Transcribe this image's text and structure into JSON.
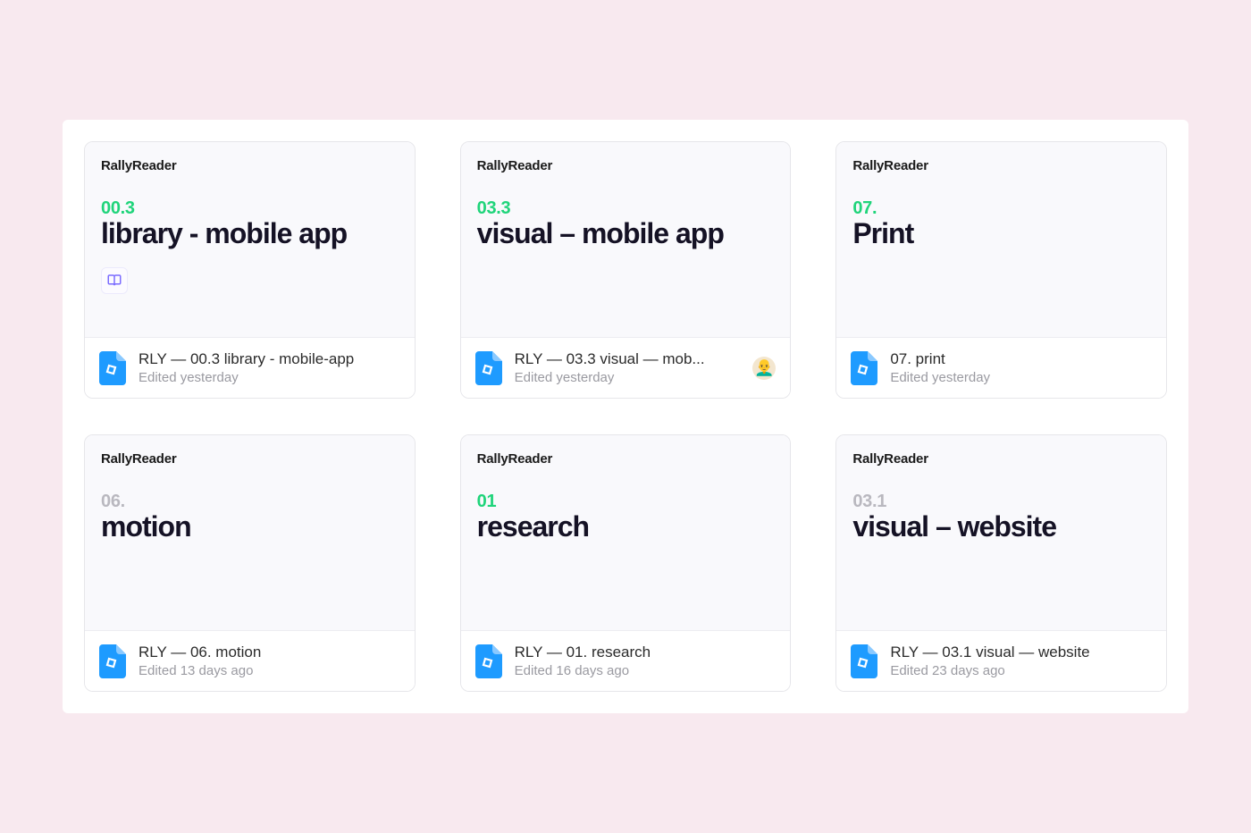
{
  "brand": "RallyReader",
  "cards": [
    {
      "num": "00.3",
      "num_color": "green",
      "title": "library - mobile app",
      "has_book_tag": true,
      "file_title": "RLY — 00.3 library - mobile-app",
      "edited": "Edited yesterday",
      "has_avatar": false
    },
    {
      "num": "03.3",
      "num_color": "green",
      "title": "visual – mobile app",
      "has_book_tag": false,
      "file_title": "RLY — 03.3 visual — mob...",
      "edited": "Edited yesterday",
      "has_avatar": true
    },
    {
      "num": "07.",
      "num_color": "green",
      "title": "Print",
      "has_book_tag": false,
      "file_title": "07. print",
      "edited": "Edited yesterday",
      "has_avatar": false
    },
    {
      "num": "06.",
      "num_color": "gray",
      "title": "motion",
      "has_book_tag": false,
      "file_title": "RLY — 06. motion",
      "edited": "Edited 13 days ago",
      "has_avatar": false
    },
    {
      "num": "01",
      "num_color": "green",
      "title": "research",
      "has_book_tag": false,
      "file_title": "RLY — 01. research",
      "edited": "Edited 16 days ago",
      "has_avatar": false
    },
    {
      "num": "03.1",
      "num_color": "gray",
      "title": "visual – website",
      "has_book_tag": false,
      "file_title": "RLY — 03.1 visual — website",
      "edited": "Edited 23 days ago",
      "has_avatar": false
    }
  ],
  "avatar_emoji": "👨‍🦲"
}
